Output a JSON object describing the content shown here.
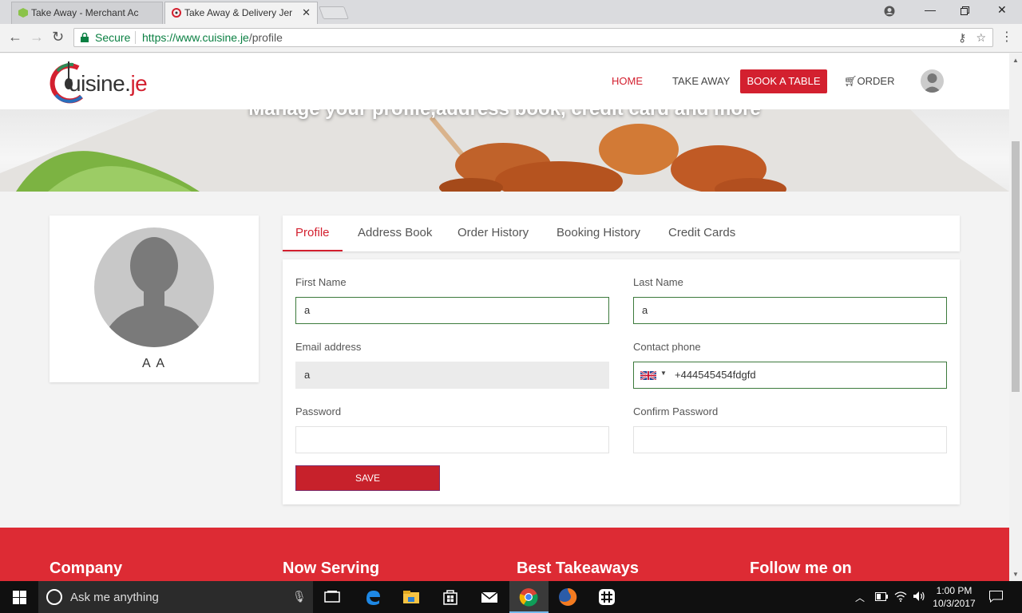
{
  "browser": {
    "tabs": [
      {
        "title": "Take Away - Merchant Ac",
        "active": false
      },
      {
        "title": "Take Away & Delivery Jer",
        "active": true
      }
    ],
    "secure_label": "Secure",
    "url_host": "https://www.cuisine.je",
    "url_path": "/profile"
  },
  "site": {
    "logo_text_main": "uisine.",
    "logo_text_accent": "je",
    "nav": {
      "home": "HOME",
      "take_away": "TAKE AWAY",
      "book_table": "BOOK A TABLE",
      "order": "ORDER"
    },
    "hero_title": "Manage your profile,address book, credit card and more"
  },
  "profile": {
    "name": "A A",
    "tabs": [
      "Profile",
      "Address Book",
      "Order History",
      "Booking History",
      "Credit Cards"
    ],
    "active_tab": "Profile",
    "form": {
      "first_name_label": "First Name",
      "first_name_value": "a",
      "last_name_label": "Last Name",
      "last_name_value": "a",
      "email_label": "Email address",
      "email_value": "a",
      "phone_label": "Contact phone",
      "phone_value": "+444545454fdgfd",
      "password_label": "Password",
      "confirm_password_label": "Confirm Password",
      "save_label": "SAVE"
    }
  },
  "footer": {
    "columns": [
      "Company",
      "Now Serving",
      "Best Takeaways",
      "Follow me on"
    ]
  },
  "taskbar": {
    "search_placeholder": "Ask me anything",
    "time": "1:00 PM",
    "date": "10/3/2017"
  },
  "colors": {
    "brand_red": "#d3202f",
    "footer_red": "#dd2b34",
    "secure_green": "#0b8043",
    "valid_green": "#3c7a3c"
  }
}
